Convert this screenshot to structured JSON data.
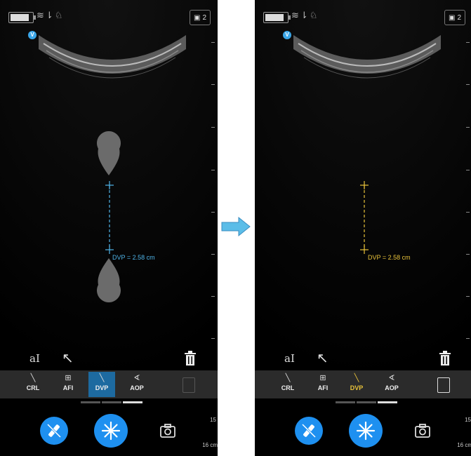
{
  "panels": [
    {
      "id": "before",
      "status": {
        "clip_count": "2"
      },
      "measurement": {
        "label": "DVP = 2.58 cm",
        "color": "#4fb4e8",
        "state": "editing"
      },
      "tools": {
        "text_tool": "aI"
      },
      "measure_bar": {
        "items": [
          {
            "label": "CRL",
            "icon": "line-icon",
            "active": false
          },
          {
            "label": "AFI",
            "icon": "afi-icon",
            "active": false
          },
          {
            "label": "DVP",
            "icon": "line-icon",
            "active": true
          },
          {
            "label": "AOP",
            "icon": "angle-icon",
            "active": false
          }
        ],
        "active_color": "#1d6aa0"
      },
      "depth": {
        "tick": "15",
        "unit_label": "16 cm"
      }
    },
    {
      "id": "after",
      "status": {
        "clip_count": "2"
      },
      "measurement": {
        "label": "DVP = 2.58 cm",
        "color": "#e8c23a",
        "state": "committed"
      },
      "tools": {
        "text_tool": "aI"
      },
      "measure_bar": {
        "items": [
          {
            "label": "CRL",
            "icon": "line-icon",
            "active": false
          },
          {
            "label": "AFI",
            "icon": "afi-icon",
            "active": false
          },
          {
            "label": "DVP",
            "icon": "line-icon",
            "active": true
          },
          {
            "label": "AOP",
            "icon": "angle-icon",
            "active": false
          }
        ],
        "active_color": "#e8c23a"
      },
      "depth": {
        "tick": "15",
        "unit_label": "16 cm"
      }
    }
  ],
  "colors": {
    "accent": "#1e90f0",
    "transition_arrow": "#5bbde8"
  }
}
